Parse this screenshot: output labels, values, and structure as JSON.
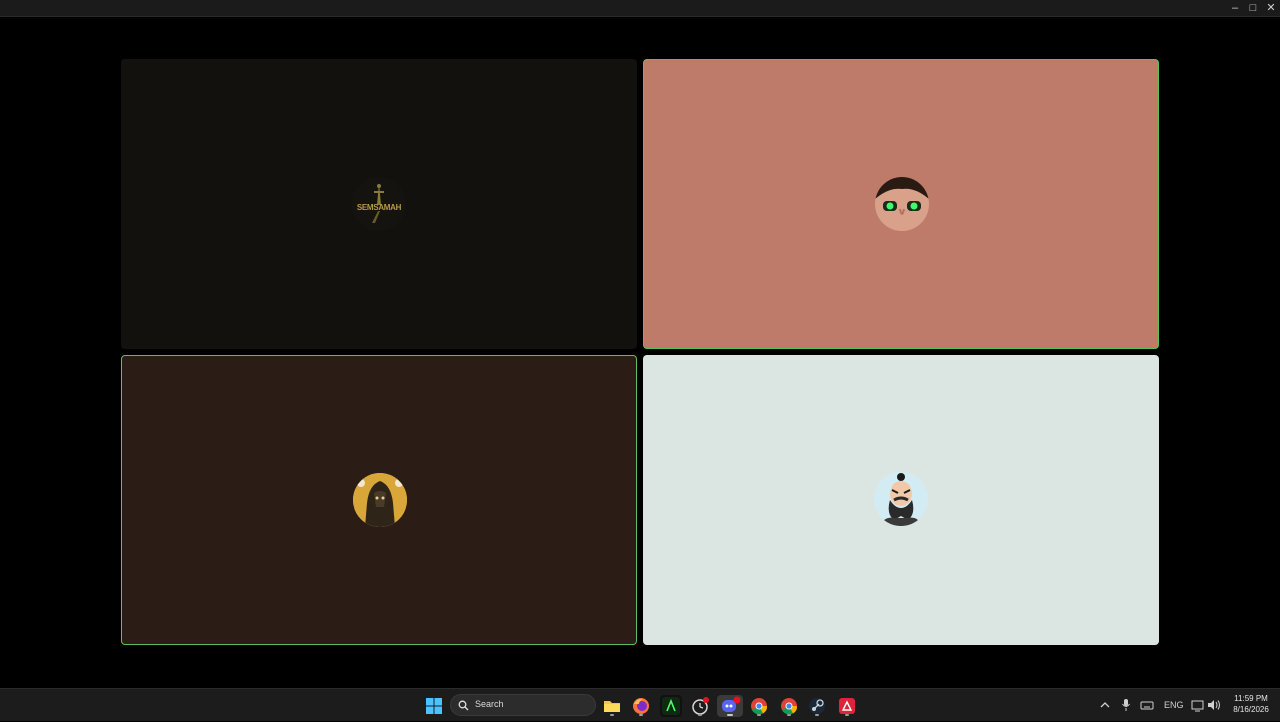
{
  "window": {
    "controls": [
      {
        "name": "minimize",
        "glyph": "–"
      },
      {
        "name": "maximize",
        "glyph": "□"
      },
      {
        "name": "close",
        "glyph": "✕"
      }
    ]
  },
  "tiles": [
    {
      "name": "participant-1",
      "bg": "#12110e",
      "speaking": false,
      "avatar": "semsamah-dagger-logo",
      "avatar_text": "SEMSAMAH"
    },
    {
      "name": "participant-2",
      "bg": "#be7b69",
      "speaking": true,
      "avatar": "face-green-eyes-icon"
    },
    {
      "name": "participant-3",
      "bg": "#2c1c16",
      "speaking": true,
      "avatar": "warrior-portrait-icon"
    },
    {
      "name": "participant-4",
      "bg": "#dbe6e2",
      "speaking": false,
      "avatar": "bearded-man-cartoon-icon"
    }
  ],
  "taskbar": {
    "search_label": "Search",
    "apps": [
      "windows-start-icon",
      "file-explorer-icon",
      "firefox-icon",
      "terminal-app-icon",
      "clock-app-icon",
      "discord-icon",
      "chrome-icon",
      "chrome-icon",
      "steam-icon",
      "red-app-icon"
    ],
    "tray": {
      "lang": "ENG",
      "time": "11:59 PM",
      "date": "8/16/2026"
    }
  }
}
